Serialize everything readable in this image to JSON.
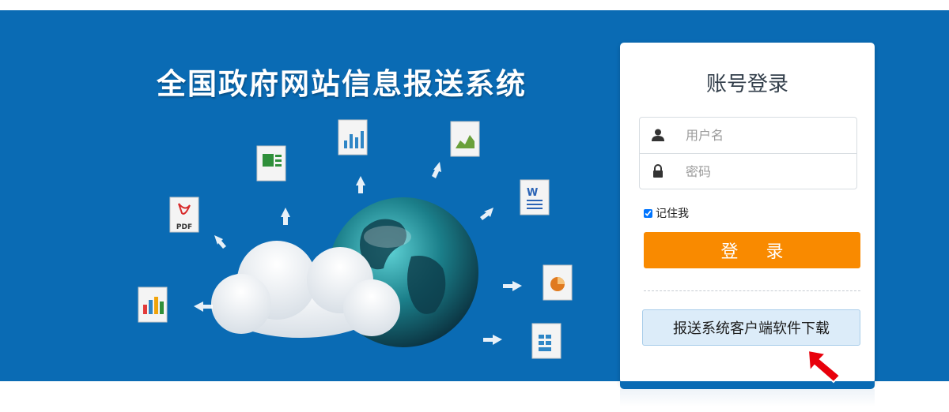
{
  "banner": {
    "title": "全国政府网站信息报送系统",
    "background_color": "#0a6bb4",
    "file_icons": [
      "pdf-file-icon",
      "excel-file-icon",
      "chart-file-icon",
      "area-chart-file-icon",
      "word-file-icon",
      "pie-chart-file-icon",
      "table-file-icon",
      "bar-chart-file-icon"
    ],
    "pdf_label": "PDF"
  },
  "login": {
    "title": "账号登录",
    "username_placeholder": "用户名",
    "password_placeholder": "密码",
    "username_icon": "user-icon",
    "password_icon": "lock-icon",
    "remember_label": "记住我",
    "remember_checked": true,
    "submit_label": "登 录",
    "submit_color": "#f98a00",
    "download_label": "报送系统客户端软件下载",
    "arrow_color": "#e8000b"
  }
}
